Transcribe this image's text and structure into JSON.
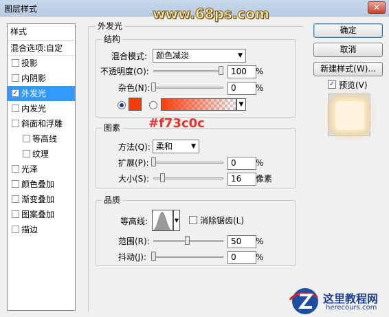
{
  "window": {
    "title": "图层样式",
    "watermark": "www.68ps.com",
    "close_glyph": "✕"
  },
  "styles": {
    "header": "样式",
    "blend_options": "混合选项:自定",
    "items": [
      {
        "label": "投影",
        "checked": false
      },
      {
        "label": "内阴影",
        "checked": false
      },
      {
        "label": "外发光",
        "checked": true,
        "selected": true
      },
      {
        "label": "内发光",
        "checked": false
      },
      {
        "label": "斜面和浮雕",
        "checked": false
      },
      {
        "label": "等高线",
        "checked": false,
        "sub": true
      },
      {
        "label": "纹理",
        "checked": false,
        "sub": true
      },
      {
        "label": "光泽",
        "checked": false
      },
      {
        "label": "颜色叠加",
        "checked": false
      },
      {
        "label": "渐变叠加",
        "checked": false
      },
      {
        "label": "图案叠加",
        "checked": false
      },
      {
        "label": "描边",
        "checked": false
      }
    ],
    "check_glyph": "✓"
  },
  "panel": {
    "title": "外发光",
    "structure": {
      "title": "结构",
      "blend_mode_label": "混合模式:",
      "blend_mode_value": "颜色减淡",
      "opacity_label": "不透明度(O):",
      "opacity_value": "100",
      "opacity_unit": "%",
      "noise_label": "杂色(N):",
      "noise_value": "0",
      "noise_unit": "%",
      "color": "#f73c0c"
    },
    "hex_note": "#f73c0c",
    "elements": {
      "title": "图素",
      "method_label": "方法(Q):",
      "method_value": "柔和",
      "spread_label": "扩展(P):",
      "spread_value": "0",
      "spread_unit": "%",
      "size_label": "大小(S):",
      "size_value": "16",
      "size_unit": "像素"
    },
    "quality": {
      "title": "品质",
      "contour_label": "等高线:",
      "antialias_label": "消除锯齿(L)",
      "range_label": "范围(R):",
      "range_value": "50",
      "range_unit": "%",
      "jitter_label": "抖动(J):",
      "jitter_value": "0",
      "jitter_unit": "%"
    }
  },
  "buttons": {
    "ok": "确定",
    "cancel": "取消",
    "new_style": "新建样式(W)...",
    "preview_label": "预览(V)",
    "preview_checked": true
  },
  "logo": {
    "name": "这里教程网",
    "url_text": "herecours.com"
  },
  "arrow_glyph": "▼"
}
